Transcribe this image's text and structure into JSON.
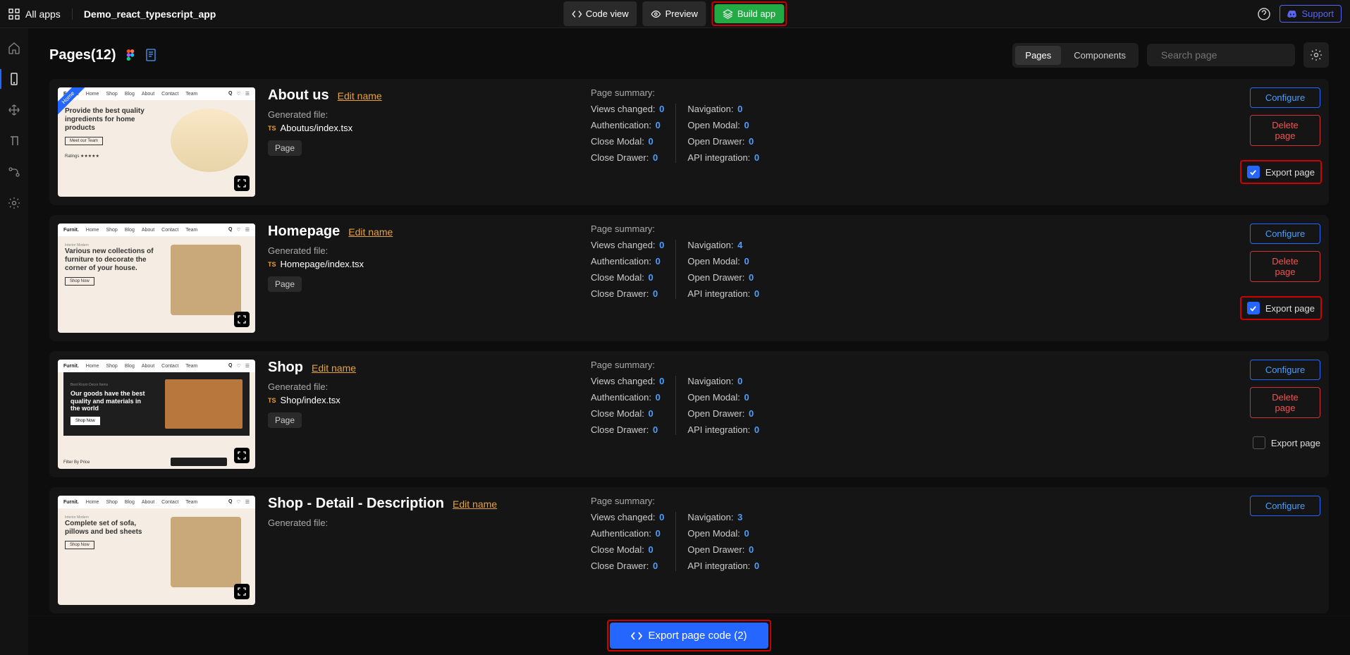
{
  "topbar": {
    "all_apps": "All apps",
    "title": "Demo_react_typescript_app",
    "code_view": "Code view",
    "preview": "Preview",
    "build_app": "Build app",
    "support": "Support"
  },
  "main_header": {
    "title": "Pages(12)",
    "tabs": {
      "pages": "Pages",
      "components": "Components"
    },
    "search_placeholder": "Search page"
  },
  "labels": {
    "edit_name": "Edit name",
    "generated_file": "Generated file:",
    "page_badge": "Page",
    "page_summary": "Page summary:",
    "configure": "Configure",
    "delete_page": "Delete page",
    "export_page": "Export page",
    "views_changed": "Views changed:",
    "navigation": "Navigation:",
    "authentication": "Authentication:",
    "open_modal": "Open Modal:",
    "close_modal": "Close Modal:",
    "open_drawer": "Open Drawer:",
    "close_drawer": "Close Drawer:",
    "api_integration": "API integration:"
  },
  "pages": [
    {
      "name": "About us",
      "file": "Aboutus/index.tsx",
      "thumb_variant": "home_ribbon",
      "thumb_headline": "Provide the best quality ingredients for home products",
      "stats": {
        "views_changed": "0",
        "navigation": "0",
        "authentication": "0",
        "open_modal": "0",
        "close_modal": "0",
        "open_drawer": "0",
        "close_drawer": "0",
        "api_integration": "0"
      },
      "export_checked": true,
      "export_highlight": true,
      "show_delete": true
    },
    {
      "name": "Homepage",
      "file": "Homepage/index.tsx",
      "thumb_variant": "light",
      "thumb_headline": "Various new collections of furniture to decorate the corner of your house.",
      "stats": {
        "views_changed": "0",
        "navigation": "4",
        "authentication": "0",
        "open_modal": "0",
        "close_modal": "0",
        "open_drawer": "0",
        "close_drawer": "0",
        "api_integration": "0"
      },
      "export_checked": true,
      "export_highlight": true,
      "show_delete": true
    },
    {
      "name": "Shop",
      "file": "Shop/index.tsx",
      "thumb_variant": "dark_hero",
      "thumb_headline": "Our goods have the best quality and materials in the world",
      "stats": {
        "views_changed": "0",
        "navigation": "0",
        "authentication": "0",
        "open_modal": "0",
        "close_modal": "0",
        "open_drawer": "0",
        "close_drawer": "0",
        "api_integration": "0"
      },
      "export_checked": false,
      "export_highlight": false,
      "show_delete": true
    },
    {
      "name": "Shop - Detail - Description",
      "file": "",
      "thumb_variant": "light",
      "thumb_headline": "Complete set of sofa, pillows and bed sheets",
      "stats": {
        "views_changed": "0",
        "navigation": "3",
        "authentication": "0",
        "open_modal": "0",
        "close_modal": "0",
        "open_drawer": "0",
        "close_drawer": "0",
        "api_integration": "0"
      },
      "export_checked": false,
      "export_highlight": false,
      "show_delete": false,
      "partial": true
    }
  ],
  "bottom": {
    "export_code": "Export page code (2)"
  }
}
